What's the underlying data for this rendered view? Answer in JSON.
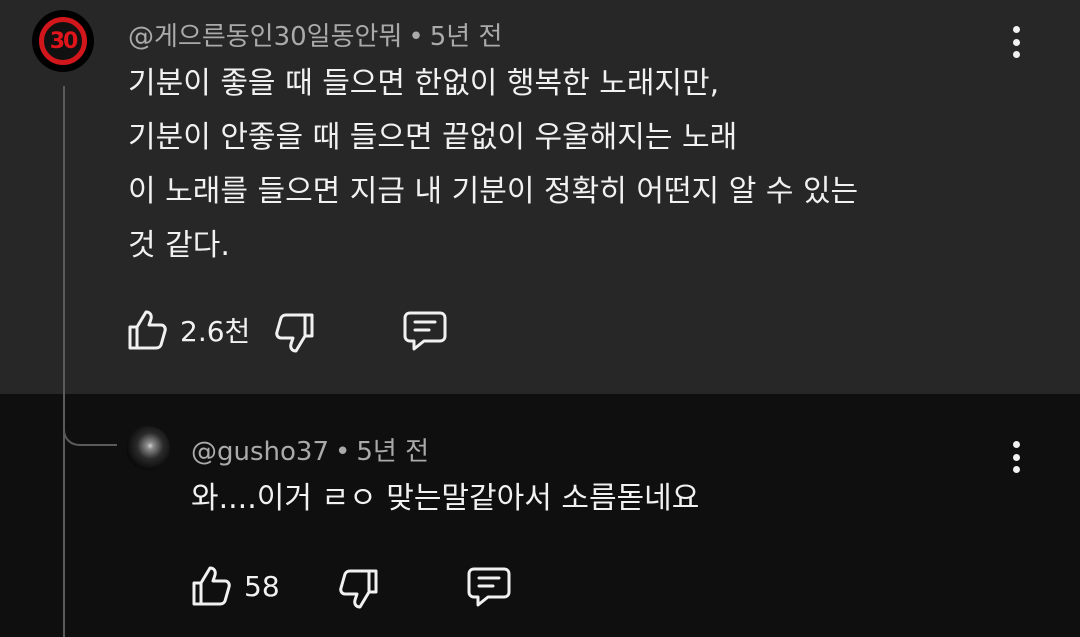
{
  "top_comment": {
    "author": "@게으른동인30일동안뭐",
    "time": "5년 전",
    "avatar_text": "30",
    "lines": [
      "기분이 좋을 때 들으면 한없이 행복한 노래지만,",
      "기분이 안좋을 때 들으면 끝없이 우울해지는 노래",
      "이 노래를 들으면 지금 내 기분이 정확히 어떤지 알 수 있는",
      "것 같다."
    ],
    "likes": "2.6천"
  },
  "reply": {
    "author": "@gusho37",
    "time": "5년 전",
    "text": "와....이거 ㄹㅇ 맞는말같아서 소름돋네요",
    "likes": "58"
  },
  "separator": "•",
  "colors": {
    "top_bg": "#272727",
    "page_bg": "#0f0f0f",
    "meta": "#aaaaaa",
    "accent_red": "#d1161c"
  },
  "icons": [
    "like-icon",
    "dislike-icon",
    "reply-icon",
    "more-options-icon"
  ]
}
